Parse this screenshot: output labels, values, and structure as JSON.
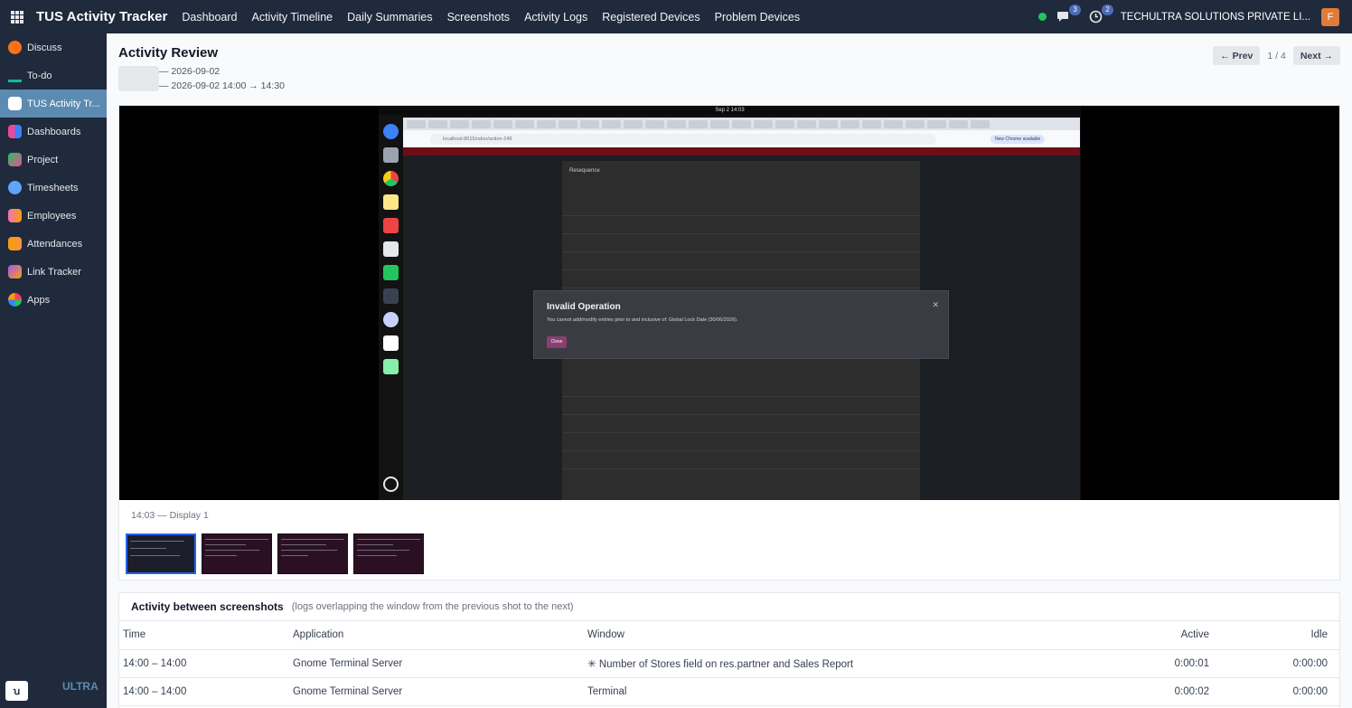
{
  "topbar": {
    "brand": "TUS Activity Tracker",
    "nav": [
      "Dashboard",
      "Activity Timeline",
      "Daily Summaries",
      "Screenshots",
      "Activity Logs",
      "Registered Devices",
      "Problem Devices"
    ],
    "messages_badge": "3",
    "activities_badge": "2",
    "company": "TECHULTRA SOLUTIONS PRIVATE LI...",
    "avatar_letter": "F"
  },
  "sidebar": {
    "items": [
      {
        "label": "Discuss",
        "icon": "discuss-icon",
        "color": "#f97316"
      },
      {
        "label": "To-do",
        "icon": "todo-icon",
        "color": "#14b8a6"
      },
      {
        "label": "TUS Activity Tr...",
        "icon": "tus-icon",
        "color": "#ffffff"
      },
      {
        "label": "Dashboards",
        "icon": "dashboards-icon",
        "color": "#ec4899"
      },
      {
        "label": "Project",
        "icon": "project-icon",
        "color": "#22c55e"
      },
      {
        "label": "Timesheets",
        "icon": "timesheets-icon",
        "color": "#60a5fa"
      },
      {
        "label": "Employees",
        "icon": "employees-icon",
        "color": "#f472b6"
      },
      {
        "label": "Attendances",
        "icon": "attendances-icon",
        "color": "#f59e0b"
      },
      {
        "label": "Link Tracker",
        "icon": "link-tracker-icon",
        "color": "#a855f7"
      },
      {
        "label": "Apps",
        "icon": "apps-icon",
        "color": "#f43f5e"
      }
    ],
    "logo_text": "ULTRA"
  },
  "review": {
    "title": "Activity Review",
    "date_line_1": "— 2026-09-02",
    "date_line_2": "— 2026-09-02 14:00 → 14:30",
    "prev_label": "← Prev",
    "next_label": "Next →",
    "pager": "1 / 4",
    "caption": "14:03 — Display 1"
  },
  "screenshot": {
    "clock": "Sep 2  14:03",
    "url": "localhost:8015/odoo/action-249",
    "new_chrome": "New Chrome available",
    "dialog_title": "Resequence",
    "error_title": "Invalid Operation",
    "error_message": "You cannot add/modify entries prior to and inclusive of: Global Lock Date (30/06/2026).",
    "error_button": "Close"
  },
  "activity": {
    "title": "Activity between screenshots",
    "subtitle": "(logs overlapping the window from the previous shot to the next)",
    "columns": [
      "Time",
      "Application",
      "Window",
      "Active",
      "Idle"
    ],
    "rows": [
      {
        "time": "14:00 – 14:00",
        "app": "Gnome Terminal Server",
        "window": "✳ Number of Stores field on res.partner and Sales Report",
        "active": "0:00:01",
        "idle": "0:00:00"
      },
      {
        "time": "14:00 – 14:00",
        "app": "Gnome Terminal Server",
        "window": "Terminal",
        "active": "0:00:02",
        "idle": "0:00:00"
      }
    ]
  }
}
